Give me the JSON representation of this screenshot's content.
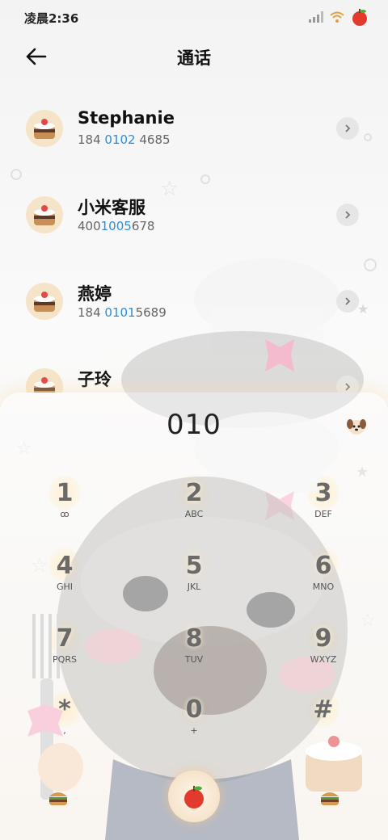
{
  "status_bar": {
    "time": "凌晨2:36",
    "icons": [
      "signal-icon",
      "wifi-icon",
      "apple-battery-icon"
    ]
  },
  "header": {
    "title": "通话",
    "back_icon": "back-arrow-icon"
  },
  "contacts": [
    {
      "name": "Stephanie",
      "number_pre": "184 ",
      "number_hl": "0102",
      "number_post": " 4685"
    },
    {
      "name": "小米客服",
      "number_pre": "400",
      "number_hl": "1005",
      "number_post": "678"
    },
    {
      "name": "燕婷",
      "number_pre": "184 ",
      "number_hl": "0101",
      "number_post": "5689"
    },
    {
      "name": "子玲",
      "number_pre": "",
      "number_hl": "",
      "number_post": ""
    }
  ],
  "dialer": {
    "dialed_number": "010",
    "keys": [
      {
        "digit": "1",
        "letters": "ꝏ"
      },
      {
        "digit": "2",
        "letters": "ABC"
      },
      {
        "digit": "3",
        "letters": "DEF"
      },
      {
        "digit": "4",
        "letters": "GHI"
      },
      {
        "digit": "5",
        "letters": "JKL"
      },
      {
        "digit": "6",
        "letters": "MNO"
      },
      {
        "digit": "7",
        "letters": "PQRS"
      },
      {
        "digit": "8",
        "letters": "TUV"
      },
      {
        "digit": "9",
        "letters": "WXYZ"
      },
      {
        "digit": "*",
        "letters": ","
      },
      {
        "digit": "0",
        "letters": "+"
      },
      {
        "digit": "#",
        "letters": ""
      }
    ],
    "call_icon": "apple-call-icon",
    "left_icon": "burger-icon",
    "right_icon": "burger-icon"
  },
  "colors": {
    "highlight": "#2a8de0",
    "accent_glow": "#f2dcc0"
  }
}
